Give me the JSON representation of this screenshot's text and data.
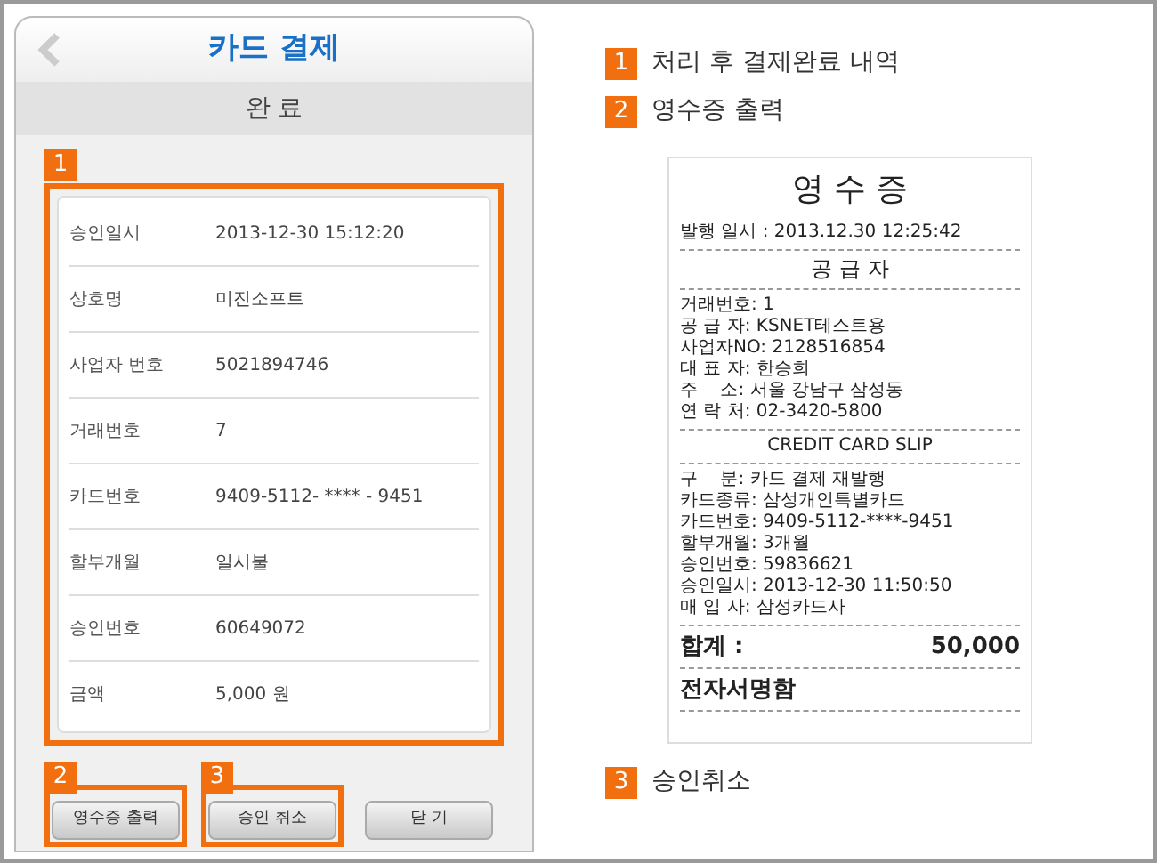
{
  "header": {
    "title": "카드 결제"
  },
  "section_title": "완 료",
  "details": {
    "callout": "1",
    "rows": [
      {
        "label": "승인일시",
        "value": "2013-12-30 15:12:20"
      },
      {
        "label": "상호명",
        "value": "미진소프트"
      },
      {
        "label": "사업자 번호",
        "value": "5021894746"
      },
      {
        "label": "거래번호",
        "value": "7"
      },
      {
        "label": "카드번호",
        "value": "9409-5112- **** - 9451"
      },
      {
        "label": "할부개월",
        "value": "일시불"
      },
      {
        "label": "승인번호",
        "value": "60649072"
      },
      {
        "label": "금액",
        "value": "5,000 원"
      }
    ]
  },
  "buttons": [
    {
      "label": "영수증 출력",
      "callout": "2"
    },
    {
      "label": "승인 취소",
      "callout": "3"
    },
    {
      "label": "닫 기"
    }
  ],
  "legend": [
    {
      "number": "1",
      "text": "처리 후 결제완료 내역"
    },
    {
      "number": "2",
      "text": "영수증 출력"
    },
    {
      "number": "3",
      "text": "승인취소"
    }
  ],
  "receipt": {
    "title": "영 수 증",
    "issued": "발행 일시 : 2013.12.30 12:25:42",
    "supplier_heading": "공 급 자",
    "supplier_lines": [
      "거래번호: 1",
      "공 급 자: KSNET테스트용",
      "사업자NO: 2128516854",
      "대 표 자: 한승희",
      "주    소: 서울 강남구 삼성동",
      "연 락 처: 02-3420-5800"
    ],
    "slip_title": "CREDIT CARD SLIP",
    "card_lines": [
      "구    분: 카드 결제 재발행",
      "카드종류: 삼성개인특별카드",
      "카드번호: 9409-5112-****-9451",
      "할부개월: 3개월",
      "승인번호: 59836621",
      "승인일시: 2013-12-30 11:50:50",
      "매 입 사: 삼성카드사"
    ],
    "total_label": "합계 :",
    "total_value": "50,000",
    "signature": "전자서명함"
  }
}
